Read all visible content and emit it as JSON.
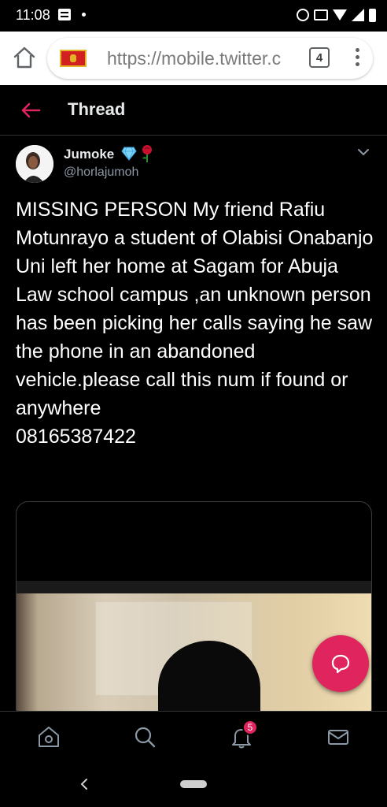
{
  "status_bar": {
    "time": "11:08",
    "icons": [
      "message-icon",
      "dot-icon",
      "alarm-icon",
      "cast-icon",
      "wifi-icon",
      "signal-icon",
      "battery-icon"
    ]
  },
  "browser": {
    "url": "https://mobile.twitter.c",
    "tab_count": "4",
    "flag": "montenegro-flag-icon"
  },
  "header": {
    "title": "Thread"
  },
  "tweet": {
    "author_name": "Jumoke",
    "handle": "@horlajumoh",
    "text": "MISSING PERSON My friend Rafiu Motunrayo a student of Olabisi Onabanjo Uni left her home at Sagam for Abuja Law school campus ,an unknown person has been picking her calls saying he saw the phone in an abandoned vehicle.please call this num if found or  anywhere\n08165387422"
  },
  "tabbar": {
    "notifications_badge": "5"
  },
  "colors": {
    "accent": "#e0245e",
    "background": "#000000",
    "secondary_text": "#8b98a5"
  }
}
